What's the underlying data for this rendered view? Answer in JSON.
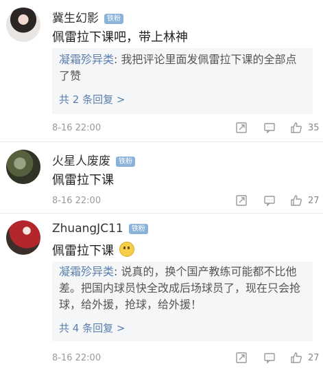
{
  "comments": [
    {
      "username": "冀生幻影",
      "badge": "铁粉",
      "content": "佩雷拉下课吧，带上林神",
      "reply": {
        "name": "凝霜殄异类",
        "separator": ": ",
        "text": "我把评论里面发佩雷拉下课的全部点了赞",
        "more": "共 2 条回复 >"
      },
      "time": "8-16 22:00",
      "likes": "35"
    },
    {
      "username": "火星人废废",
      "badge": "铁粉",
      "content": "佩雷拉下课",
      "time": "8-16 22:00",
      "likes": "27"
    },
    {
      "username": "ZhuangJC11",
      "badge": "铁粉",
      "content": "佩雷拉下课",
      "emoji": "thinking-face-icon",
      "reply": {
        "name": "凝霜殄异类",
        "separator": ": ",
        "text": "说真的，换个国产教练可能都不比他差。把国内球员快全改成后场球员了，现在只会抢球，给外援，抢球，给外援！",
        "more": "共 4 条回复 >"
      },
      "time": "8-16 22:00",
      "likes": "27"
    }
  ],
  "icons": {
    "share": "share-icon",
    "comment": "comment-icon",
    "like": "thumbs-up-icon"
  },
  "colors": {
    "link": "#5b7fad",
    "badge": "#8bb3d9",
    "reply_bg": "#f4f6f8"
  }
}
